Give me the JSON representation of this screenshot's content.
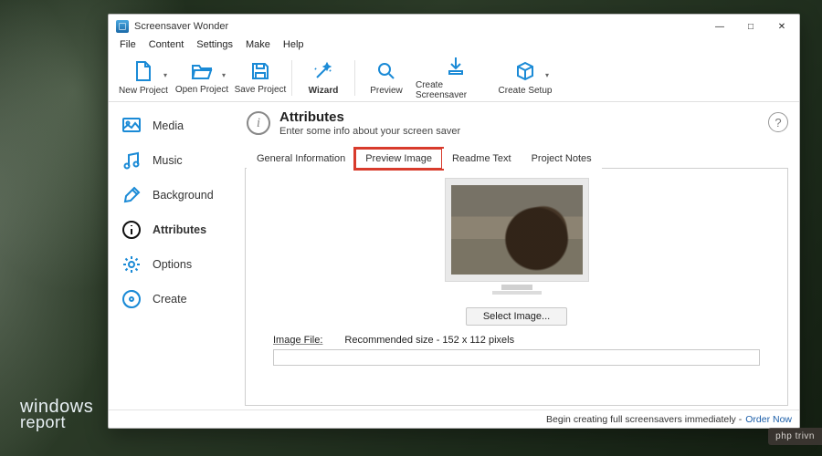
{
  "watermark": {
    "line1": "windows",
    "line2": "report"
  },
  "window": {
    "title": "Screensaver Wonder",
    "menu": [
      "File",
      "Content",
      "Settings",
      "Make",
      "Help"
    ],
    "toolbar": [
      {
        "id": "new-project",
        "label": "New Project",
        "caret": true
      },
      {
        "id": "open-project",
        "label": "Open Project",
        "caret": true
      },
      {
        "id": "save-project",
        "label": "Save Project",
        "caret": false
      },
      {
        "sep": true
      },
      {
        "id": "wizard",
        "label": "Wizard",
        "caret": false,
        "bold": true
      },
      {
        "sep": true
      },
      {
        "id": "preview",
        "label": "Preview",
        "caret": false
      },
      {
        "id": "create-ss",
        "label": "Create Screensaver",
        "caret": false,
        "wide": true
      },
      {
        "id": "create-setup",
        "label": "Create Setup",
        "caret": true
      }
    ]
  },
  "sidebar": {
    "items": [
      {
        "id": "media",
        "label": "Media"
      },
      {
        "id": "music",
        "label": "Music"
      },
      {
        "id": "background",
        "label": "Background"
      },
      {
        "id": "attributes",
        "label": "Attributes",
        "active": true
      },
      {
        "id": "options",
        "label": "Options"
      },
      {
        "id": "create",
        "label": "Create"
      }
    ]
  },
  "content": {
    "heading": "Attributes",
    "subheading": "Enter some info about your screen saver",
    "tabs": [
      {
        "id": "general",
        "label": "General Information"
      },
      {
        "id": "preview",
        "label": "Preview Image",
        "active": true,
        "highlight": true
      },
      {
        "id": "readme",
        "label": "Readme Text"
      },
      {
        "id": "notes",
        "label": "Project Notes"
      }
    ],
    "select_button": "Select Image...",
    "image_file_label": "Image File:",
    "recommended": "Recommended size - 152 x 112 pixels",
    "input_value": ""
  },
  "footer": {
    "text": "Begin creating full screensavers immediately - ",
    "link": "Order Now"
  },
  "badge": "php trivn"
}
